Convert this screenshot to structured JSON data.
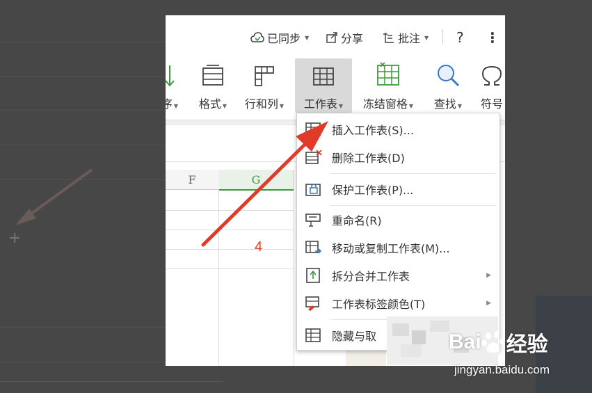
{
  "topbar": {
    "sync": "已同步",
    "share": "分享",
    "annotate": "批注",
    "help": "?",
    "more": "⋮"
  },
  "ribbon": {
    "sort_partial": "序",
    "format": "格式",
    "rowcol": "行和列",
    "worksheet": "工作表",
    "freeze": "冻结窗格",
    "find": "查找",
    "symbol": "符号"
  },
  "grid": {
    "columns": [
      "F",
      "G"
    ],
    "selected_column": "G"
  },
  "annotation": {
    "step": "4"
  },
  "menu": {
    "items": [
      {
        "label": "插入工作表(S)...",
        "icon": "insert-sheet-icon",
        "submenu": false
      },
      {
        "label": "删除工作表(D)",
        "icon": "delete-sheet-icon",
        "submenu": false
      },
      {
        "label": "保护工作表(P)...",
        "icon": "protect-sheet-icon",
        "submenu": false
      },
      {
        "label": "重命名(R)",
        "icon": "rename-icon",
        "submenu": false
      },
      {
        "label": "移动或复制工作表(M)...",
        "icon": "move-copy-sheet-icon",
        "submenu": false
      },
      {
        "label": "拆分合并工作表",
        "icon": "split-merge-icon",
        "submenu": true
      },
      {
        "label": "工作表标签颜色(T)",
        "icon": "tab-color-icon",
        "submenu": true
      },
      {
        "label": "隐藏与取",
        "icon": "hide-sheet-icon",
        "submenu": true
      }
    ]
  },
  "watermark": {
    "brand": "Bai",
    "brand_suffix": "经验",
    "url": "jingyan.baidu.com"
  },
  "colors": {
    "arrow": "#e03a28",
    "selected_column": "#3c9a3c",
    "active_button": "#d9d9d9"
  }
}
